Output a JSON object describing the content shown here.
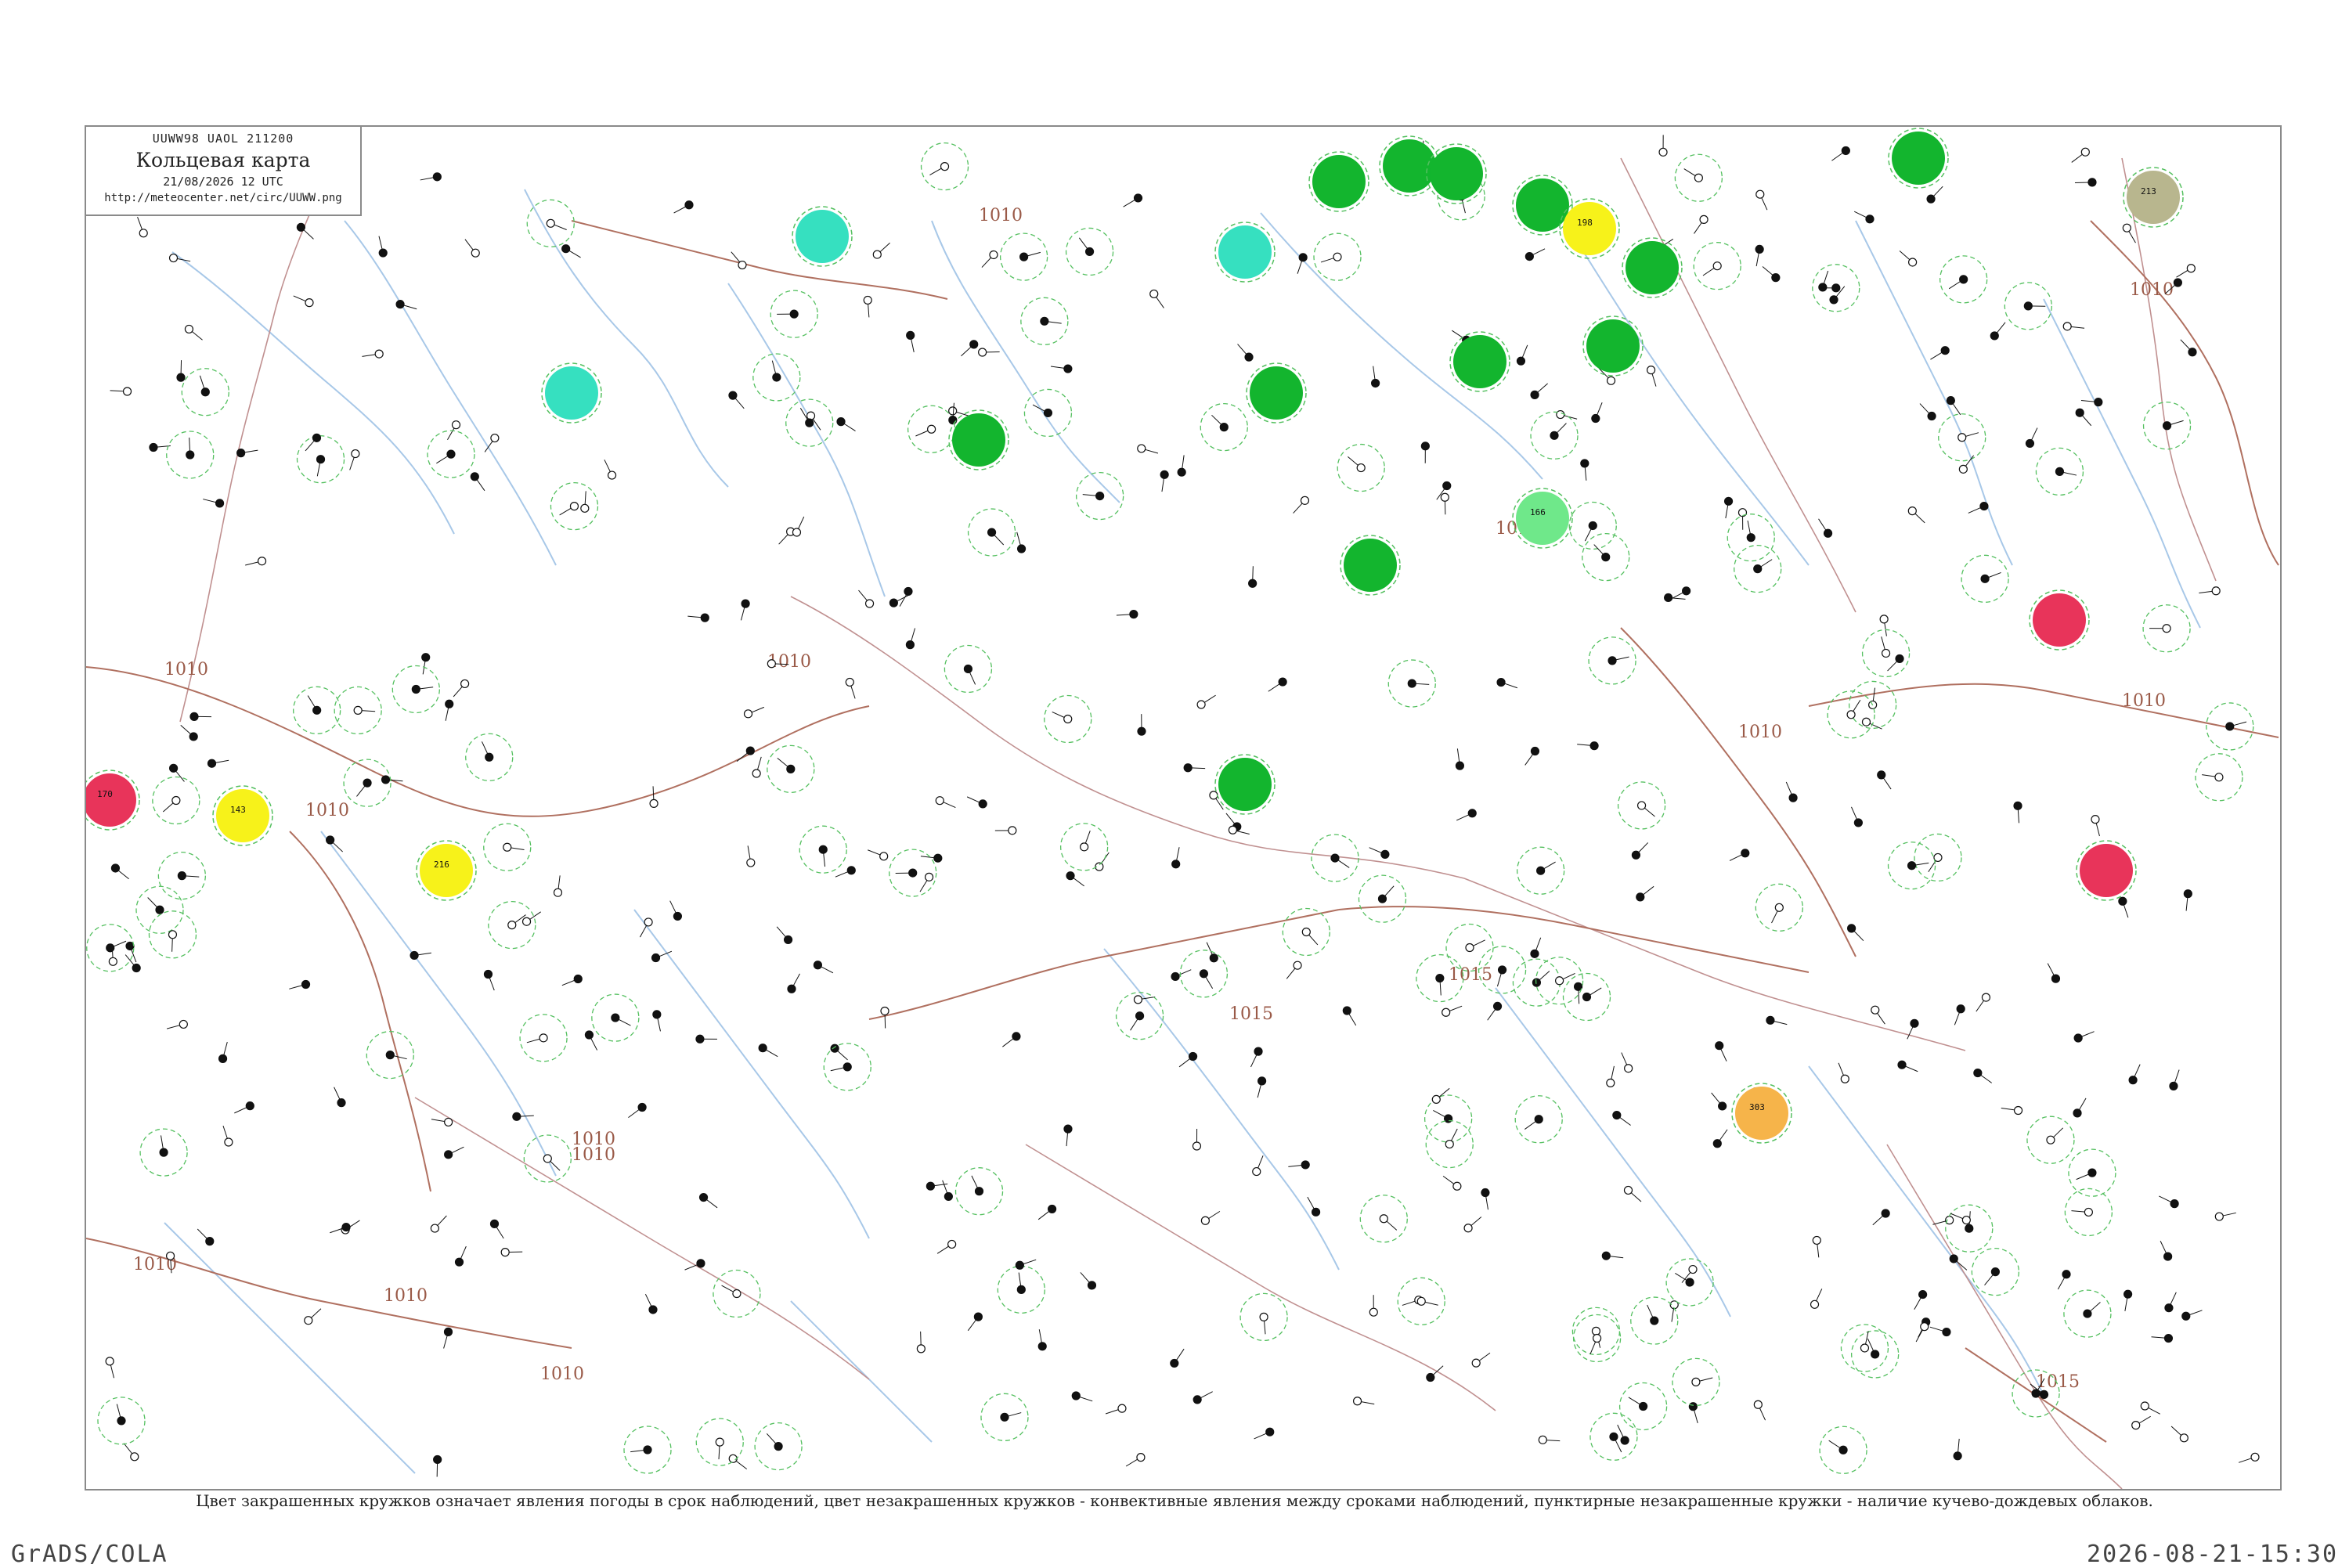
{
  "header": {
    "code": "UUWW98  UAOL  211200",
    "title": "Кольцевая карта",
    "datetime": "21/08/2026 12 UTC",
    "url": "http://meteocenter.net/circ/UUWW.png"
  },
  "caption": "Цвет закрашенных кружков означает явления погоды в срок наблюдений, цвет незакрашенных кружков - конвективные явления между сроками наблюдений, пунктирные незакрашенные кружки - наличие кучево-дождевых облаков.",
  "footer": {
    "left": "GrADS/COLA",
    "right": "2026-08-21-15:30"
  },
  "colors": {
    "frame": "#8a8a8a",
    "isobar": "#b07060",
    "river": "#a8c8e8",
    "border": "#c09090",
    "green_fill": "#13b52e",
    "cyan_fill": "#36e0c0",
    "yellow_fill": "#f7f21a",
    "red_fill": "#e8345a",
    "orange_fill": "#f6b44a",
    "olive_fill": "#b8b68e",
    "light_green_fill": "#6fe88a",
    "dashed_ring": "#55c060",
    "red_ring": "#e05070"
  },
  "isobar_labels": [
    "1010",
    "1010",
    "1010",
    "1010",
    "1010",
    "1010",
    "1010",
    "1010",
    "1010",
    "1015",
    "1015",
    "1015",
    "1010",
    "1010",
    "1010",
    "1010"
  ],
  "markers": [
    {
      "fill": "green",
      "label": ""
    },
    {
      "fill": "green",
      "label": ""
    },
    {
      "fill": "green",
      "label": ""
    },
    {
      "fill": "green",
      "label": ""
    },
    {
      "fill": "green",
      "label": ""
    },
    {
      "fill": "green",
      "label": ""
    },
    {
      "fill": "green",
      "label": ""
    },
    {
      "fill": "green",
      "label": ""
    },
    {
      "fill": "green",
      "label": ""
    },
    {
      "fill": "green",
      "label": ""
    },
    {
      "fill": "green",
      "label": ""
    },
    {
      "fill": "green",
      "label": ""
    },
    {
      "fill": "cyan",
      "label": ""
    },
    {
      "fill": "cyan",
      "label": ""
    },
    {
      "fill": "cyan",
      "label": ""
    },
    {
      "fill": "yellow",
      "label": "198"
    },
    {
      "fill": "yellow",
      "label": "143"
    },
    {
      "fill": "yellow",
      "label": "216"
    },
    {
      "fill": "red",
      "label": "170"
    },
    {
      "fill": "red",
      "label": ""
    },
    {
      "fill": "red",
      "label": ""
    },
    {
      "fill": "orange",
      "label": "303"
    },
    {
      "fill": "olive",
      "label": "213"
    },
    {
      "fill": "light_green",
      "label": "166"
    }
  ]
}
